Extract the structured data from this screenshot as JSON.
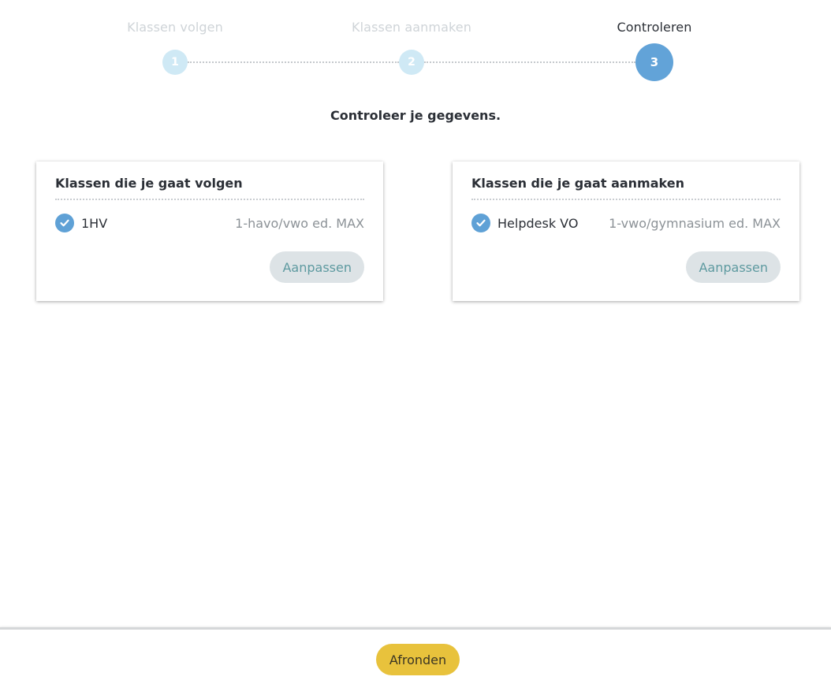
{
  "stepper": {
    "steps": [
      {
        "number": "1",
        "label": "Klassen volgen",
        "state": "done"
      },
      {
        "number": "2",
        "label": "Klassen aanmaken",
        "state": "done"
      },
      {
        "number": "3",
        "label": "Controleren",
        "state": "active"
      }
    ]
  },
  "intro": "Controleer je gegevens.",
  "cards": [
    {
      "title": "Klassen die je gaat volgen",
      "row": {
        "name": "1HV",
        "description": "1-havo/vwo ed. MAX",
        "icon": "check-circle-icon"
      },
      "button": "Aanpassen"
    },
    {
      "title": "Klassen die je gaat aanmaken",
      "row": {
        "name": "Helpdesk VO",
        "description": "1-vwo/gymnasium ed. MAX",
        "icon": "check-circle-icon"
      },
      "button": "Aanpassen"
    }
  ],
  "footer": {
    "finish_label": "Afronden"
  },
  "colors": {
    "accent_blue": "#62a3d8",
    "step_done": "#cfe9f5",
    "finish_yellow": "#e8c23c",
    "edit_button_bg": "#dde3e6"
  }
}
